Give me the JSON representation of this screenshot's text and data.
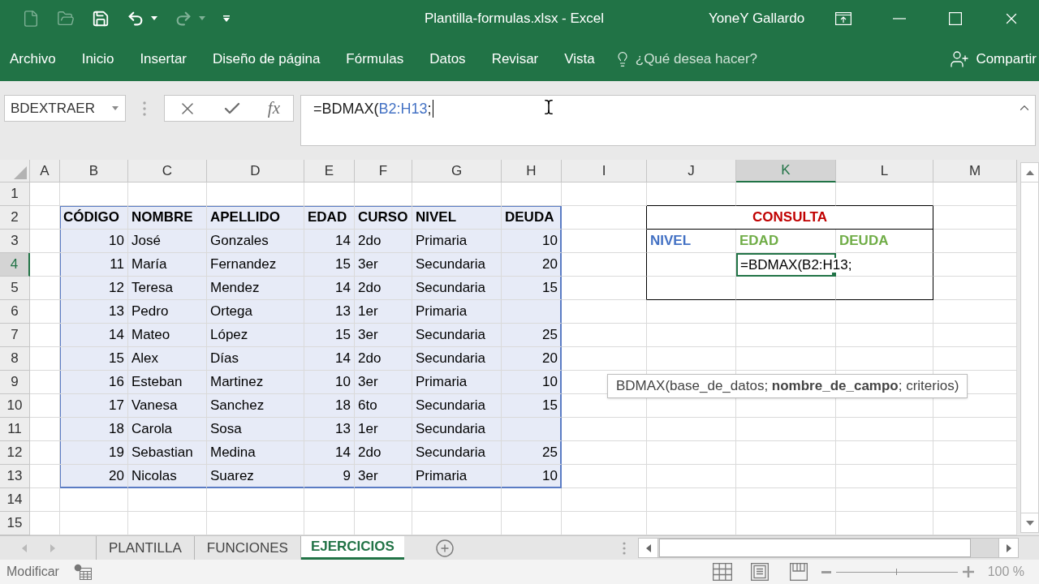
{
  "title_bar": {
    "quick_access": [
      {
        "kind": "new",
        "disabled": true
      },
      {
        "kind": "open",
        "disabled": true
      },
      {
        "kind": "save",
        "disabled": false
      },
      {
        "kind": "undo",
        "disabled": false
      },
      {
        "kind": "redo",
        "disabled": true
      },
      {
        "kind": "customize",
        "disabled": false
      }
    ],
    "title": "Plantilla-formulas.xlsx - Excel",
    "user": "YoneY Gallardo"
  },
  "ribbon": {
    "tabs": [
      "Archivo",
      "Inicio",
      "Insertar",
      "Diseño de página",
      "Fórmulas",
      "Datos",
      "Revisar",
      "Vista"
    ],
    "tell_me": {
      "placeholder": "¿Qué desea hacer?"
    },
    "share": "Compartir"
  },
  "formula_bar": {
    "name_box": "BDEXTRAER",
    "insert_function": "fx",
    "formula": [
      {
        "kind": "plain",
        "text": "=BDMAX("
      },
      {
        "kind": "reference",
        "text": "B2:H13"
      },
      {
        "kind": "plain",
        "text": ";"
      }
    ]
  },
  "sheet": {
    "column_headers": [
      {
        "label": "A",
        "selected": false
      },
      {
        "label": "B",
        "selected": false
      },
      {
        "label": "C",
        "selected": false
      },
      {
        "label": "D",
        "selected": false
      },
      {
        "label": "E",
        "selected": false
      },
      {
        "label": "F",
        "selected": false
      },
      {
        "label": "G",
        "selected": false
      },
      {
        "label": "H",
        "selected": false
      },
      {
        "label": "I",
        "selected": false
      },
      {
        "label": "J",
        "selected": false
      },
      {
        "label": "K",
        "selected": true
      },
      {
        "label": "L",
        "selected": false
      },
      {
        "label": "M",
        "selected": false
      }
    ],
    "row_headers": [
      {
        "label": "1",
        "selected": false
      },
      {
        "label": "2",
        "selected": false
      },
      {
        "label": "3",
        "selected": false
      },
      {
        "label": "4",
        "selected": true
      },
      {
        "label": "5",
        "selected": false
      },
      {
        "label": "6",
        "selected": false
      },
      {
        "label": "7",
        "selected": false
      },
      {
        "label": "8",
        "selected": false
      },
      {
        "label": "9",
        "selected": false
      },
      {
        "label": "10",
        "selected": false
      },
      {
        "label": "11",
        "selected": false
      },
      {
        "label": "12",
        "selected": false
      },
      {
        "label": "13",
        "selected": false
      },
      {
        "label": "14",
        "selected": false
      },
      {
        "label": "15",
        "selected": false
      }
    ]
  },
  "data_table": {
    "reference_highlight": true,
    "columns": [
      {
        "label": "CÓDIGO",
        "kind": "number"
      },
      {
        "label": "NOMBRE",
        "kind": "text"
      },
      {
        "label": "APELLIDO",
        "kind": "text"
      },
      {
        "label": "EDAD",
        "kind": "number"
      },
      {
        "label": "CURSO",
        "kind": "text"
      },
      {
        "label": "NIVEL",
        "kind": "text"
      },
      {
        "label": "DEUDA",
        "kind": "number"
      }
    ],
    "rows": [
      [
        "10",
        "José",
        "Gonzales",
        "14",
        "2do",
        "Primaria",
        "10"
      ],
      [
        "11",
        "María",
        "Fernandez",
        "15",
        "3er",
        "Secundaria",
        "20"
      ],
      [
        "12",
        "Teresa",
        "Mendez",
        "14",
        "2do",
        "Secundaria",
        "15"
      ],
      [
        "13",
        "Pedro",
        "Ortega",
        "13",
        "1er",
        "Primaria",
        null
      ],
      [
        "14",
        "Mateo",
        "López",
        "15",
        "3er",
        "Secundaria",
        "25"
      ],
      [
        "15",
        "Alex",
        "Días",
        "14",
        "2do",
        "Secundaria",
        "20"
      ],
      [
        "16",
        "Esteban",
        "Martinez",
        "10",
        "3er",
        "Primaria",
        "10"
      ],
      [
        "17",
        "Vanesa",
        "Sanchez",
        "18",
        "6to",
        "Secundaria",
        "15"
      ],
      [
        "18",
        "Carola",
        "Sosa",
        "13",
        "1er",
        "Secundaria",
        null
      ],
      [
        "19",
        "Sebastian",
        "Medina",
        "14",
        "2do",
        "Secundaria",
        "25"
      ],
      [
        "20",
        "Nicolas",
        "Suarez",
        "9",
        "3er",
        "Primaria",
        "10"
      ]
    ]
  },
  "consulta": {
    "title": "CONSULTA",
    "fields": [
      {
        "label": "NIVEL",
        "color": "#4472c4"
      },
      {
        "label": "EDAD",
        "color": "#70ad47"
      },
      {
        "label": "DEUDA",
        "color": "#70ad47"
      }
    ],
    "active_cell": "=BDMAX(B2:H13;"
  },
  "tooltip": "BDMAX(base_de_datos; **nombre_de_campo**; criterios)",
  "sheet_tabs": [
    {
      "label": "PLANTILLA",
      "selected": false
    },
    {
      "label": "FUNCIONES",
      "selected": false
    },
    {
      "label": "EJERCICIOS",
      "selected": true
    }
  ],
  "status_bar": {
    "mode": "Modificar",
    "zoom_slider": {
      "level": 0.5
    },
    "zoom": "100 %"
  }
}
